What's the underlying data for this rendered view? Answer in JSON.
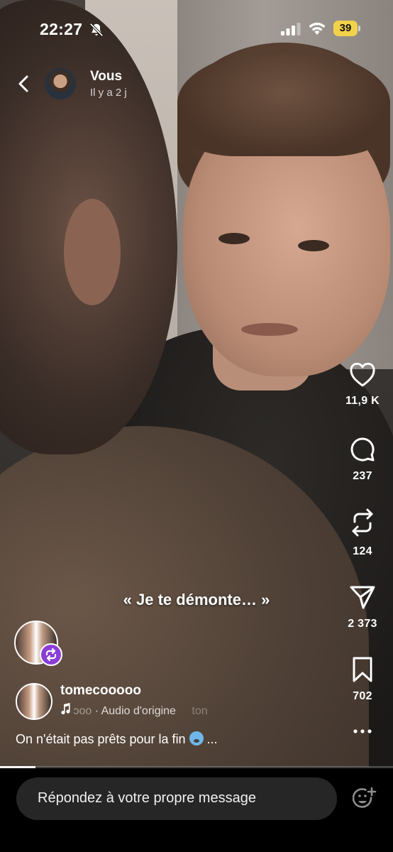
{
  "status_bar": {
    "time": "22:27",
    "battery": "39"
  },
  "header": {
    "username": "Vous",
    "timestamp": "Il y a 2 j"
  },
  "overlay_caption": "« Je te démonte… »",
  "actions": {
    "like_count": "11,9 K",
    "comment_count": "237",
    "repost_count": "124",
    "share_count": "2 373",
    "save_count": "702"
  },
  "post": {
    "author": "tomecooooo",
    "audio_left": "ɔoo",
    "audio_separator": "·",
    "audio_label": "Audio d'origine",
    "audio_right": "ton",
    "description": "On n'était pas prêts pour la fin",
    "more": "..."
  },
  "progress_fraction": 0.09,
  "reply": {
    "placeholder": "Répondez à votre propre message"
  },
  "colors": {
    "battery": "#f2d24a",
    "repost_badge": "#8b3dd8",
    "input_bg": "#262626"
  }
}
